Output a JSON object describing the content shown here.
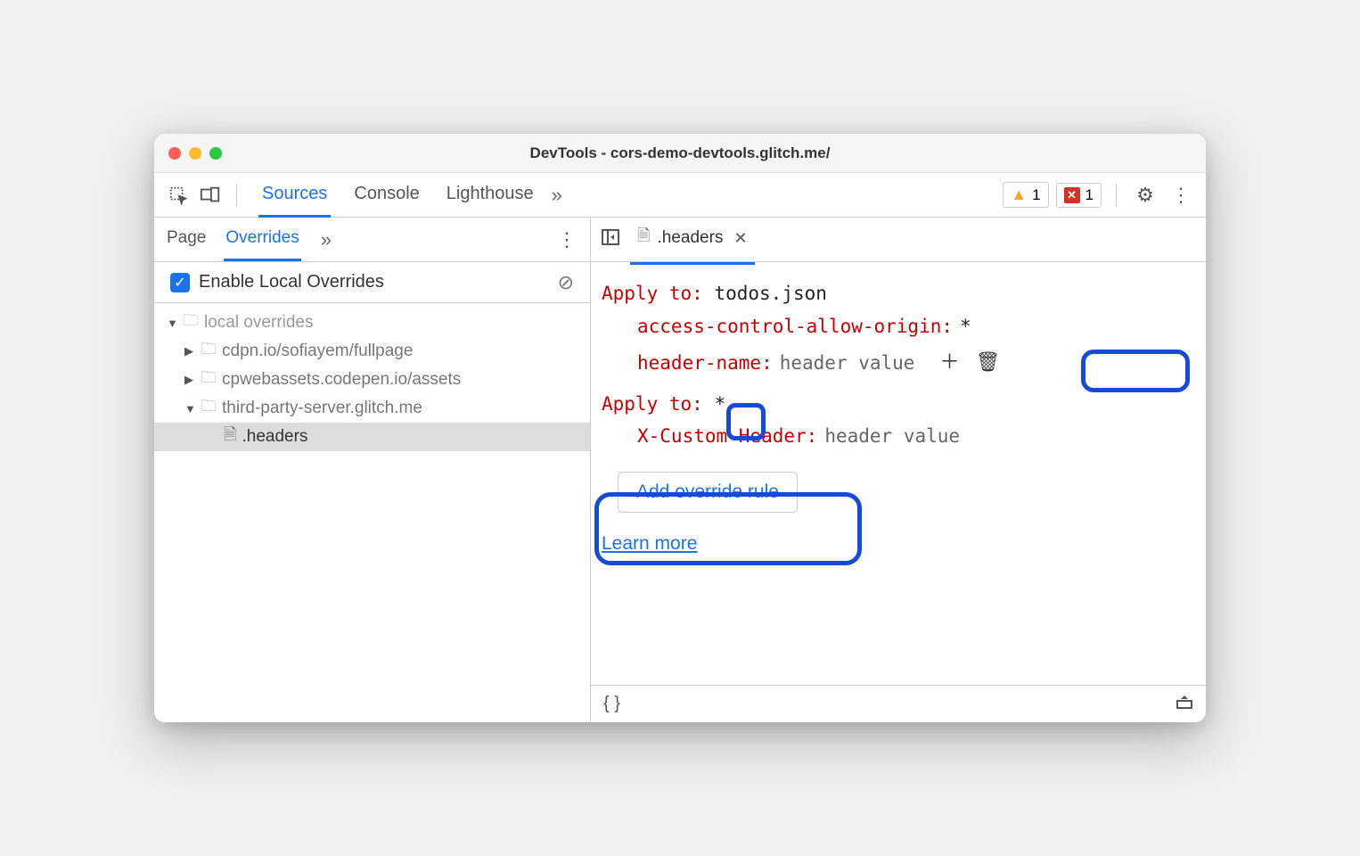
{
  "window": {
    "title": "DevTools - cors-demo-devtools.glitch.me/"
  },
  "toolbar": {
    "main_tabs": [
      "Sources",
      "Console",
      "Lighthouse"
    ],
    "warning_count": "1",
    "error_count": "1"
  },
  "sidebar": {
    "sub_tabs": [
      "Page",
      "Overrides"
    ],
    "enable_label": "Enable Local Overrides",
    "tree": {
      "root": "local overrides",
      "items": [
        "cdpn.io/sofiayem/fullpage",
        "cpwebassets.codepen.io/assets",
        "third-party-server.glitch.me"
      ],
      "file": ".headers"
    }
  },
  "editor": {
    "tab_name": ".headers",
    "rules": [
      {
        "apply_label": "Apply to",
        "apply_value": "todos.json",
        "headers": [
          {
            "name": "access-control-allow-origin",
            "value": "*"
          },
          {
            "name": "header-name",
            "value": "header value"
          }
        ]
      },
      {
        "apply_label": "Apply to",
        "apply_value": "*",
        "headers": [
          {
            "name": "X-Custom-Header",
            "value": "header value"
          }
        ]
      }
    ],
    "add_button": "Add override rule",
    "learn_more": "Learn more"
  }
}
